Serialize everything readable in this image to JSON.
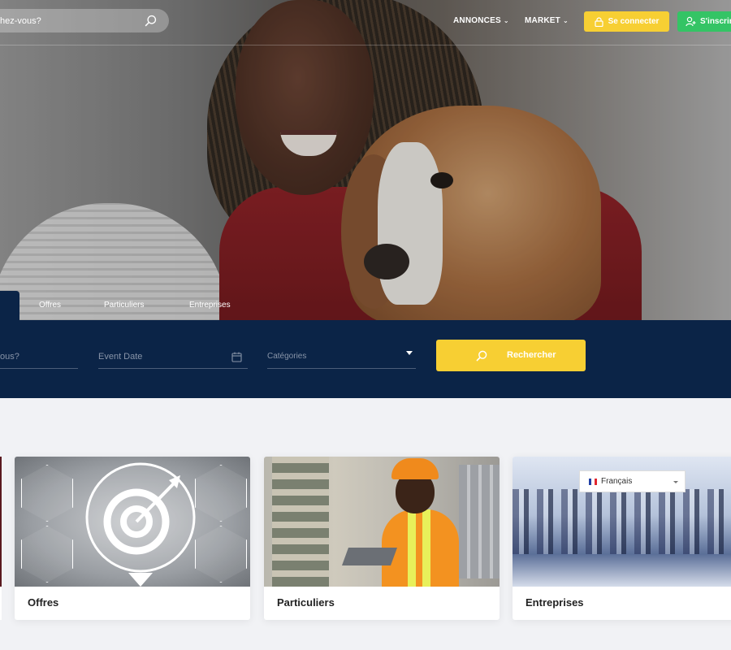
{
  "header": {
    "search_placeholder": "hez-vous?",
    "nav": [
      {
        "label": "ANNONCES"
      },
      {
        "label": "MARKET"
      }
    ],
    "login_label": "Se connecter",
    "signup_label": "S'inscrir"
  },
  "tabs": [
    {
      "label": "Offres"
    },
    {
      "label": "Particuliers"
    },
    {
      "label": "Entreprises"
    }
  ],
  "search_form": {
    "keyword_placeholder": "ous?",
    "date_placeholder": "Event Date",
    "category_placeholder": "Catégories",
    "submit_label": "Rechercher"
  },
  "cards": [
    {
      "title": "Offres"
    },
    {
      "title": "Particuliers"
    },
    {
      "title": "Entreprises"
    }
  ],
  "language_selector": {
    "value": "Français"
  },
  "colors": {
    "navy": "#0b2447",
    "yellow": "#f7cf33",
    "green": "#34c465"
  }
}
